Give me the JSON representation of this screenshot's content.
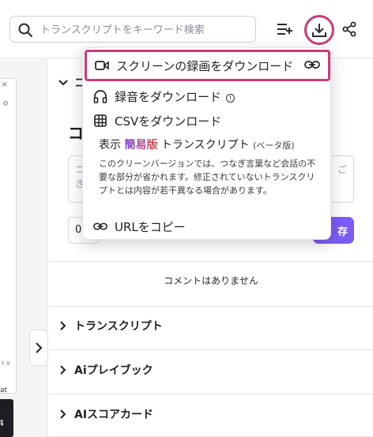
{
  "search": {
    "placeholder": "トランスクリプトをキーワード検索"
  },
  "toolbar": {
    "icons": [
      "playlist-add-icon",
      "download-icon",
      "share-icon"
    ]
  },
  "left_pane": {
    "bottom_text": "at",
    "thumb_text": "4",
    "tiny_text": "F 8"
  },
  "main": {
    "collapsed_section_initial": "コ",
    "comment_title_initial": "コ",
    "comment_placeholder_start": "コ",
    "comment_placeholder_line2": "き",
    "comment_placeholder_right": "ご",
    "timestamp_value": "0",
    "save_label": "存",
    "no_comments": "コメントはありません",
    "accordions": [
      {
        "label": "トランスクリプト"
      },
      {
        "label": "Aiプレイブック"
      },
      {
        "label": "AIスコアカード"
      }
    ]
  },
  "menu": {
    "screen_recording": "スクリーンの録画をダウンロード",
    "audio": "録音をダウンロード",
    "csv": "CSVをダウンロード",
    "concise_prefix": "表示 ",
    "concise_brand": "簡易版",
    "concise_suffix": " トランスクリプト",
    "concise_beta": "(ベータ版)",
    "concise_desc": "このクリーンバージョンでは、つなぎ言葉など会話の不要な部分が省かれます。修正されていないトランスクリプトとは内容が若干異なる場合があります。",
    "copy_url": "URLをコピー"
  },
  "colors": {
    "highlight": "#cc3a78",
    "accent": "#7c5cf5"
  }
}
